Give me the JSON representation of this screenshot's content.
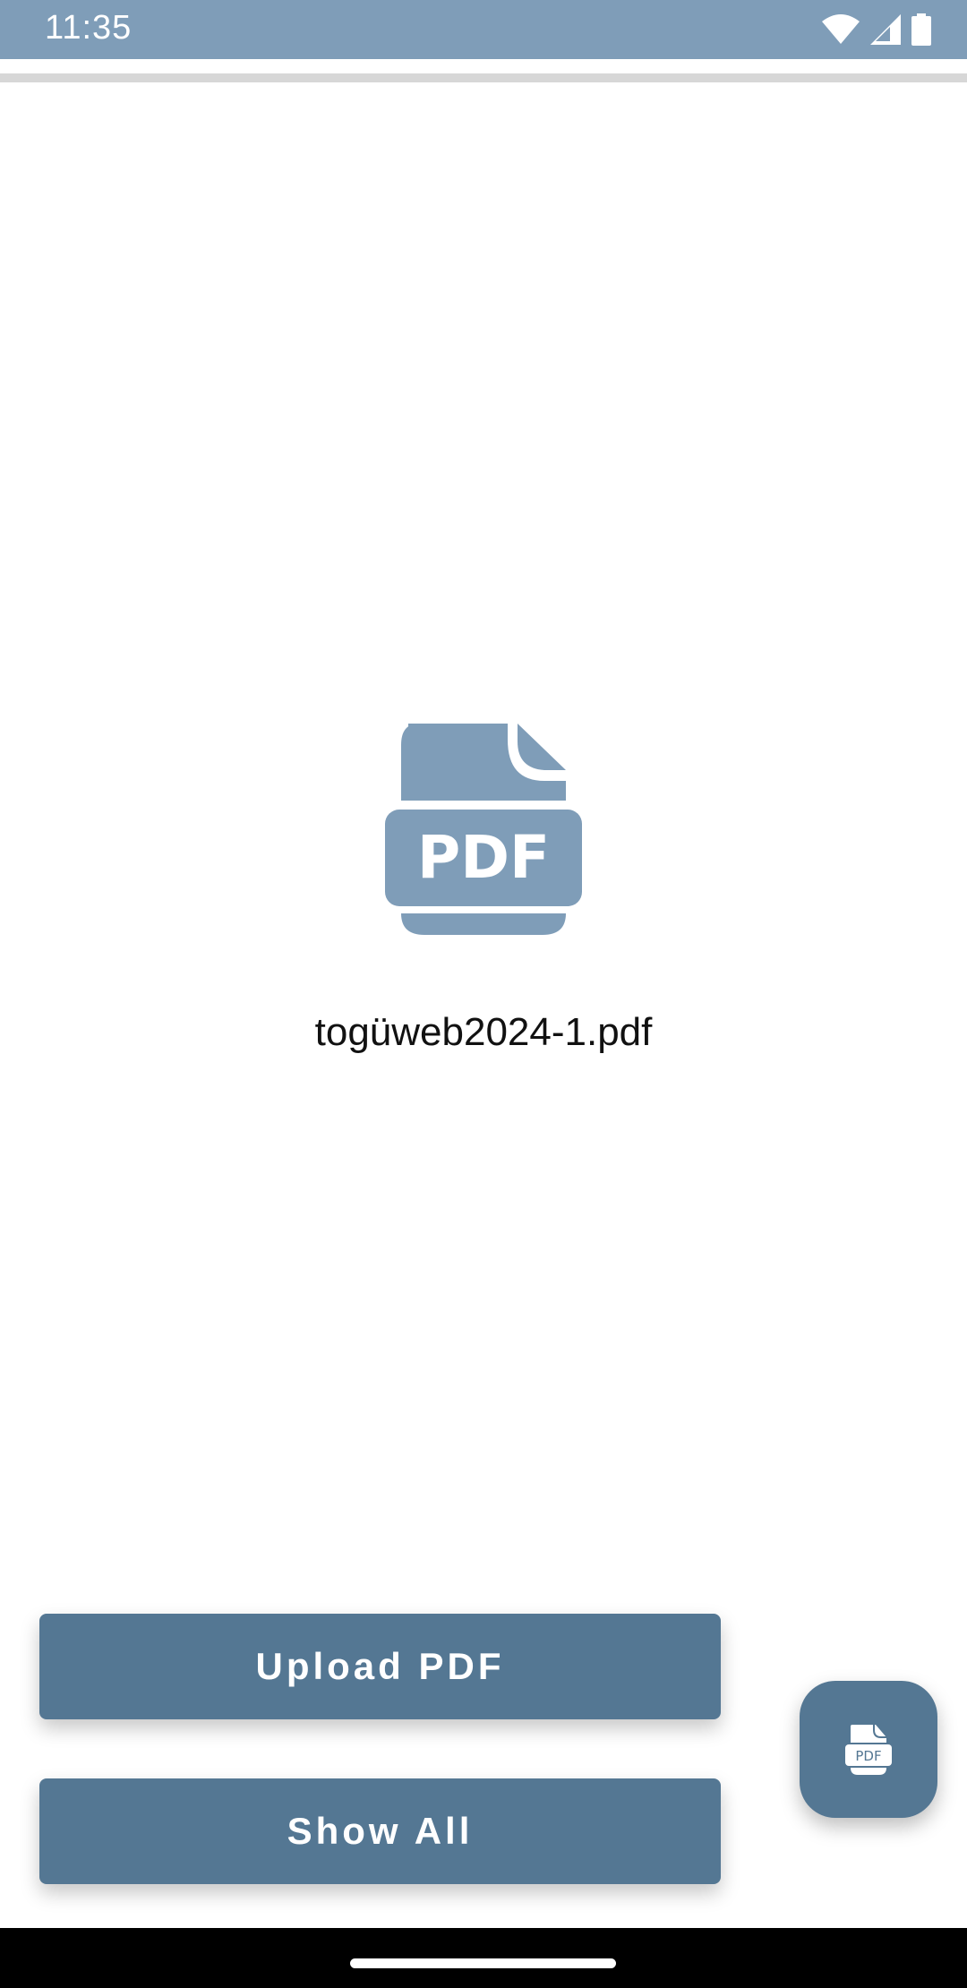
{
  "status_bar": {
    "time": "11:35",
    "icons": [
      "wifi-icon",
      "signal-icon",
      "battery-icon"
    ],
    "background": "#7f9db8"
  },
  "main": {
    "file_icon": "pdf-file-icon",
    "file_icon_label": "PDF",
    "file_name": "togüweb2024-1.pdf"
  },
  "actions": {
    "upload_label": "Upload PDF",
    "show_all_label": "Show All",
    "fab_icon": "pdf-icon",
    "fab_icon_label": "PDF"
  },
  "colors": {
    "accent": "#547793",
    "icon_tint": "#7f9db8"
  }
}
